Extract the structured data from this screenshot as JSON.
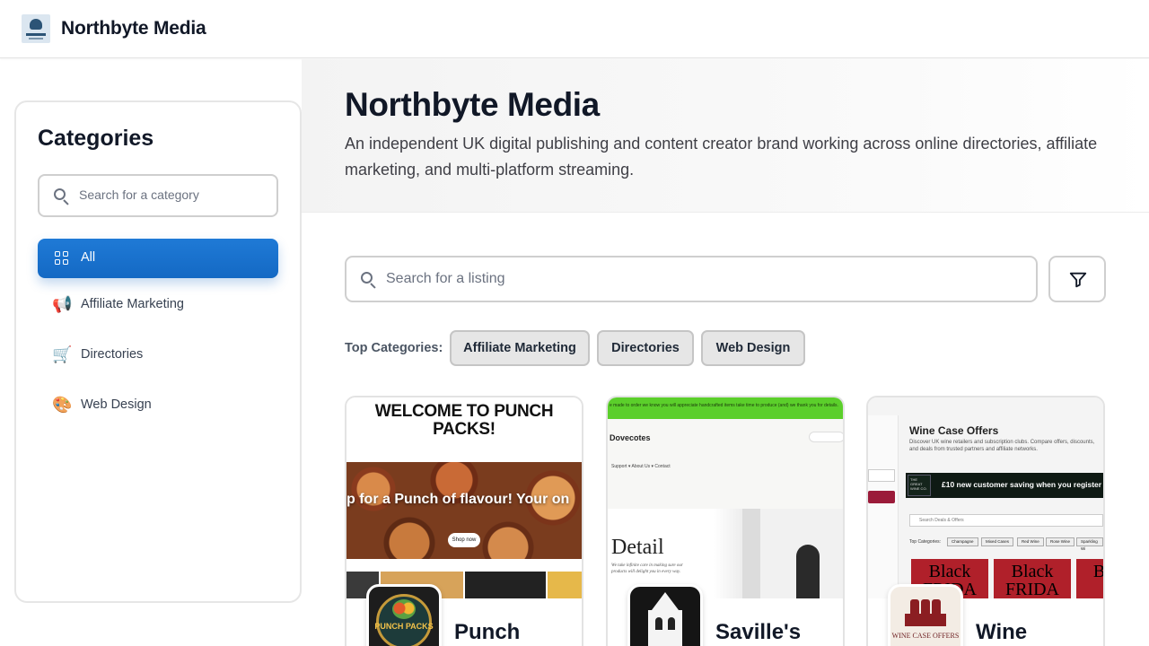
{
  "header": {
    "brand": "Northbyte Media"
  },
  "hero": {
    "title": "Northbyte Media",
    "description": "An independent UK digital publishing and content creator brand working across online directories, affiliate marketing, and multi-platform streaming."
  },
  "sidebar": {
    "title": "Categories",
    "search_placeholder": "Search for a category",
    "items": [
      {
        "label": "All",
        "icon": "grid-icon",
        "active": true
      },
      {
        "label": "Affiliate Marketing",
        "icon": "megaphone-icon",
        "glyph": "📢"
      },
      {
        "label": "Directories",
        "icon": "shopping-cart-icon",
        "glyph": "🛒"
      },
      {
        "label": "Web Design",
        "icon": "palette-icon",
        "glyph": "🎨"
      }
    ]
  },
  "listing_search": {
    "placeholder": "Search for a listing"
  },
  "top_categories": {
    "label": "Top Categories:",
    "chips": [
      "Affiliate Marketing",
      "Directories",
      "Web Design"
    ]
  },
  "listings": [
    {
      "name": "Punch",
      "thumb": {
        "title": "WELCOME TO PUNCH PACKS!",
        "banner": "p for a Punch of flavour!  Your on",
        "button": "Shop now"
      },
      "avatar_text": "PUNCH PACKS"
    },
    {
      "name": "Saville's",
      "thumb": {
        "announcement": "e made to order we know you will appreciate handcrafted items take time to produce (and) we thank you for details.",
        "logo": "Dovecotes",
        "nav": "Support ▾    About Us ▾    Contact",
        "heading": "Detail",
        "caption": "We take infinite care in making sure our products will delight you in every way."
      }
    },
    {
      "name": "Wine",
      "thumb": {
        "title": "Wine Case Offers",
        "subtitle": "Discover UK wine retailers and subscription clubs. Compare offers, discounts, and deals from trusted partners and affiliate networks.",
        "banner": "£10 new customer saving when you register",
        "banner_logo": "THE GREAT WINE CO.",
        "search": "Search Deals & Offers",
        "top_categories": "Top Categories:",
        "chips": [
          "Champagne",
          "Mixed Cases",
          "Red Wine",
          "Rose Wine",
          "Sparkling Wi"
        ],
        "promo": [
          "Black FRIDA",
          "Black FRIDA",
          "Bl FR"
        ]
      },
      "avatar_text": "WINE CASE OFFERS"
    }
  ],
  "colors": {
    "accent": "#1a72cf",
    "text": "#111827",
    "muted": "#6b7280"
  }
}
